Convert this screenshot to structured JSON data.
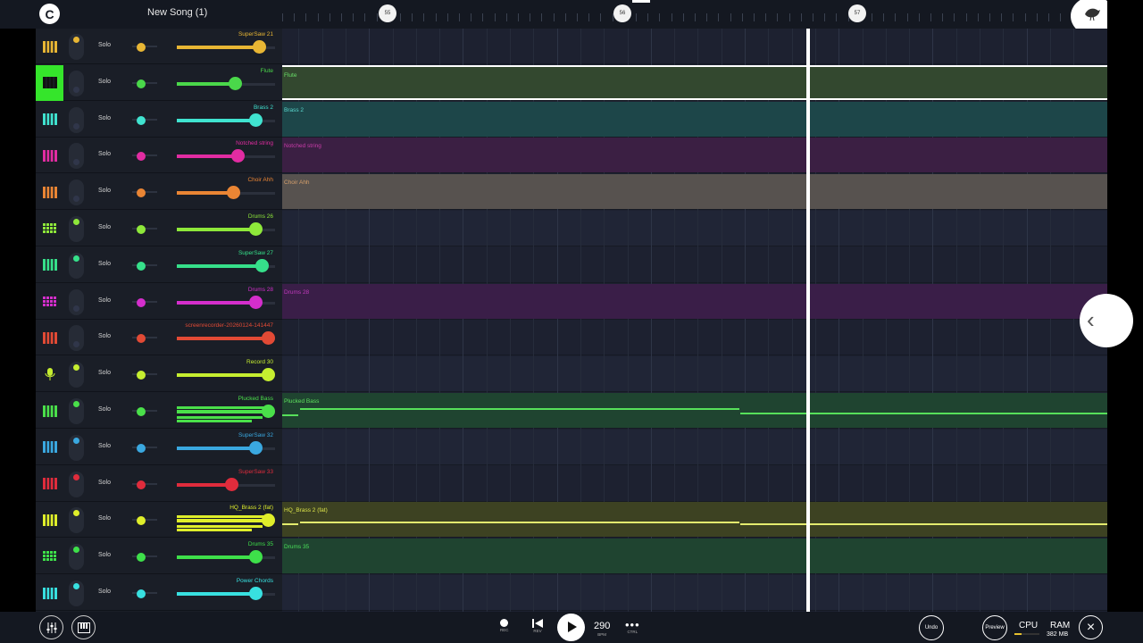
{
  "header": {
    "logo_glyph": "C",
    "song_title": "New Song (1)",
    "ruler_markers": [
      "55",
      "56",
      "57"
    ]
  },
  "tracks": [
    {
      "name": "SuperSaw 21",
      "color": "#e8b634",
      "icon": "keyboard-icon",
      "volume": 0.84,
      "selected": false,
      "mute_on": true
    },
    {
      "name": "Flute",
      "color": "#4ad84a",
      "icon": "keyboard-icon",
      "volume": 0.59,
      "selected": true,
      "mute_on": false
    },
    {
      "name": "Brass 2",
      "color": "#40e3d0",
      "icon": "keyboard-icon",
      "volume": 0.8,
      "selected": false,
      "mute_on": false
    },
    {
      "name": "Notched string",
      "color": "#e22ca2",
      "icon": "keyboard-icon",
      "volume": 0.62,
      "selected": false,
      "mute_on": false
    },
    {
      "name": "Choir Ahh",
      "color": "#ea8534",
      "icon": "keyboard-icon",
      "volume": 0.57,
      "selected": false,
      "mute_on": false
    },
    {
      "name": "Drums 26",
      "color": "#8ee83a",
      "icon": "drum-grid-icon",
      "volume": 0.8,
      "selected": false,
      "mute_on": true
    },
    {
      "name": "SuperSaw 27",
      "color": "#36e08a",
      "icon": "keyboard-icon",
      "volume": 0.86,
      "selected": false,
      "mute_on": true
    },
    {
      "name": "Drums 28",
      "color": "#d42ecc",
      "icon": "drum-grid-icon",
      "volume": 0.8,
      "selected": false,
      "mute_on": false
    },
    {
      "name": "screenrecorder-20260124-141447",
      "color": "#e24a35",
      "icon": "keyboard-icon",
      "volume": 0.93,
      "selected": false,
      "mute_on": false
    },
    {
      "name": "Record 30",
      "color": "#c6ee30",
      "icon": "microphone-icon",
      "volume": 0.93,
      "selected": false,
      "mute_on": true
    },
    {
      "name": "Plucked Bass",
      "color": "#4ae04a",
      "icon": "keyboard-icon",
      "volume": 0.93,
      "selected": false,
      "mute_on": true
    },
    {
      "name": "SuperSaw 32",
      "color": "#3aa8e0",
      "icon": "keyboard-icon",
      "volume": 0.8,
      "selected": false,
      "mute_on": true
    },
    {
      "name": "SuperSaw 33",
      "color": "#e02c3c",
      "icon": "keyboard-icon",
      "volume": 0.55,
      "selected": false,
      "mute_on": true
    },
    {
      "name": "HQ_Brass 2 (fat)",
      "color": "#dfee2a",
      "icon": "keyboard-icon",
      "volume": 0.93,
      "selected": false,
      "mute_on": true
    },
    {
      "name": "Drums 35",
      "color": "#3ee04a",
      "icon": "drum-grid-icon",
      "volume": 0.8,
      "selected": false,
      "mute_on": true
    },
    {
      "name": "Power Chords",
      "color": "#38e0e0",
      "icon": "keyboard-icon",
      "volume": 0.8,
      "selected": false,
      "mute_on": true
    }
  ],
  "solo_label": "Solo",
  "lanes": [
    {
      "region": null
    },
    {
      "region": {
        "label": "Flute",
        "bg": "#33482f",
        "text": "#69e069",
        "outline": "#ffffff"
      }
    },
    {
      "region": {
        "label": "Brass 2",
        "bg": "#1d4649",
        "text": "#5ad8cf"
      }
    },
    {
      "region": {
        "label": "Notched string",
        "bg": "#3b1f43",
        "text": "#c83ca8"
      }
    },
    {
      "region": {
        "label": "Choir Ahh",
        "bg": "#57524f",
        "text": "#d49f6b"
      }
    },
    {
      "region": null
    },
    {
      "region": null
    },
    {
      "region": {
        "label": "Drums 28",
        "bg": "#3a1e48",
        "text": "#c23abe"
      }
    },
    {
      "region": null
    },
    {
      "region": null
    },
    {
      "region": {
        "label": "Plucked Bass",
        "bg": "#1f4430",
        "text": "#5de05d",
        "notes": true,
        "note_color": "#57e05a"
      }
    },
    {
      "region": null
    },
    {
      "region": null
    },
    {
      "region": {
        "label": "HQ_Brass 2 (fat)",
        "bg": "#3d4222",
        "text": "#dde54a",
        "notes": true,
        "note_color": "#e4ec6e"
      }
    },
    {
      "region": {
        "label": "Drums 35",
        "bg": "#1f4430",
        "text": "#4ae05a"
      }
    },
    {
      "region": null
    }
  ],
  "transport": {
    "rec_label": "REC",
    "rev_label": "REV",
    "bpm": "290",
    "bpm_label": "BPM",
    "ctrl_label": "CTRL"
  },
  "footer": {
    "undo_label": "Undo",
    "preview_label": "Preview",
    "cpu_label": "CPU",
    "cpu_level": 0.3,
    "ram_label": "RAM",
    "ram_value": "382 MB"
  }
}
